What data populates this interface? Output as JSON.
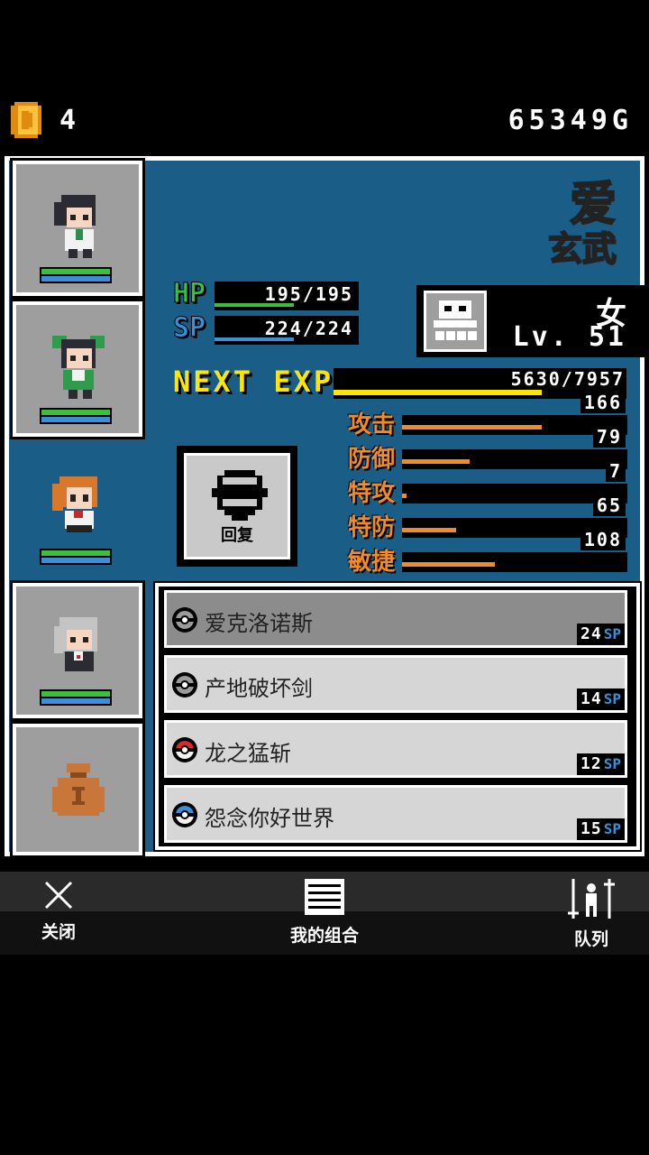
{
  "currency": {
    "dice_count": "4",
    "gold": "65349G"
  },
  "character": {
    "name": "爱",
    "class": "玄武",
    "gender": "女",
    "level": "Lv. 51",
    "hp": {
      "label": "HP",
      "value": "195/195",
      "ratio": 1.0
    },
    "sp": {
      "label": "SP",
      "value": "224/224",
      "ratio": 1.0
    },
    "exp": {
      "label": "NEXT EXP",
      "value": "5630/7957",
      "ratio": 0.71
    }
  },
  "attributes": [
    {
      "name": "攻击",
      "value": "166",
      "ratio": 0.62
    },
    {
      "name": "防御",
      "value": "79",
      "ratio": 0.3
    },
    {
      "name": "特攻",
      "value": "7",
      "ratio": 0.02
    },
    {
      "name": "特防",
      "value": "65",
      "ratio": 0.24
    },
    {
      "name": "敏捷",
      "value": "108",
      "ratio": 0.41
    }
  ],
  "restore_button": {
    "label": "回复"
  },
  "skills": [
    {
      "name": "爱克洛诺斯",
      "cost": "24",
      "unit": "SP",
      "orb": "gray"
    },
    {
      "name": "产地破坏剑",
      "cost": "14",
      "unit": "SP",
      "orb": "gray"
    },
    {
      "name": "龙之猛斩",
      "cost": "12",
      "unit": "SP",
      "orb": "red"
    },
    {
      "name": "怨念你好世界",
      "cost": "15",
      "unit": "SP",
      "orb": "blue"
    }
  ],
  "nav": {
    "close": "关闭",
    "combo": "我的组合",
    "formation": "队列"
  },
  "colors": {
    "panel_bg": "#1a5e88",
    "hp_green": "#3cbf3c",
    "sp_blue": "#3a8fd8",
    "exp_yellow": "#ffe600",
    "attr_orange": "#f08a2a"
  }
}
